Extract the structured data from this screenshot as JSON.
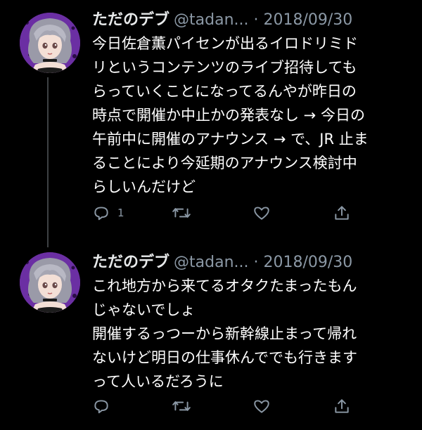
{
  "theme": {
    "background": "#000000",
    "text": "#ffffff",
    "secondary": "#8b98a5",
    "thread_line": "#3e4144"
  },
  "tweets": [
    {
      "author": {
        "display_name": "ただのデブ",
        "handle": "@tadan...",
        "avatar": "avatar-anime-girl-icon"
      },
      "separator": "·",
      "date": "2018/09/30",
      "lines": [
        "今日佐倉薫パイセンが出るイロドリミド",
        "リというコンテンツのライブ招待しても",
        "らっていくことになってるんやが昨日の",
        "時点で開催か中止かの発表なし → 今日の",
        "午前中に開催のアナウンス → で、JR 止ま",
        "ることにより今延期のアナウンス検討中",
        "らしいんだけど"
      ],
      "actions": {
        "reply_count": "1",
        "retweet_count": "",
        "like_count": ""
      }
    },
    {
      "author": {
        "display_name": "ただのデブ",
        "handle": "@tadan...",
        "avatar": "avatar-anime-girl-icon"
      },
      "separator": "·",
      "date": "2018/09/30",
      "lines": [
        "これ地方から来てるオタクたまったもん",
        "じゃないでしょ",
        "開催するっつーから新幹線止まって帰れ",
        "ないけど明日の仕事休んででも行きます",
        "って人いるだろうに"
      ],
      "actions": {
        "reply_count": "",
        "retweet_count": "",
        "like_count": ""
      }
    }
  ]
}
